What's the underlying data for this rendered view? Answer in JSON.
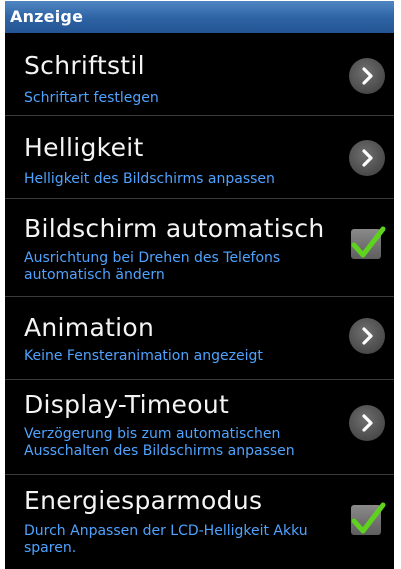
{
  "header": {
    "title": "Anzeige"
  },
  "rows": [
    {
      "title": "Schriftstil",
      "subtitle": "Schriftart festlegen",
      "control": "chevron-icon"
    },
    {
      "title": "Helligkeit",
      "subtitle": "Helligkeit des Bildschirms anpassen",
      "control": "chevron-icon"
    },
    {
      "title": "Bildschirm automatisch drehen",
      "subtitle": "Ausrichtung bei Drehen des Telefons automatisch ändern",
      "control": "checkbox",
      "checked": true
    },
    {
      "title": "Animation",
      "subtitle": "Keine Fensteranimation angezeigt",
      "control": "chevron-icon"
    },
    {
      "title": "Display-Timeout",
      "subtitle": "Verzögerung bis zum automatischen Ausschalten des Bildschirms anpassen",
      "control": "chevron-icon"
    },
    {
      "title": "Energiesparmodus",
      "subtitle": "Durch Anpassen der LCD-Helligkeit Akku sparen.",
      "control": "checkbox",
      "checked": true
    }
  ],
  "colors": {
    "header_bg": "#2d62a3",
    "subtitle_text": "#4fa3ff",
    "check_mark": "#5fd21e"
  }
}
